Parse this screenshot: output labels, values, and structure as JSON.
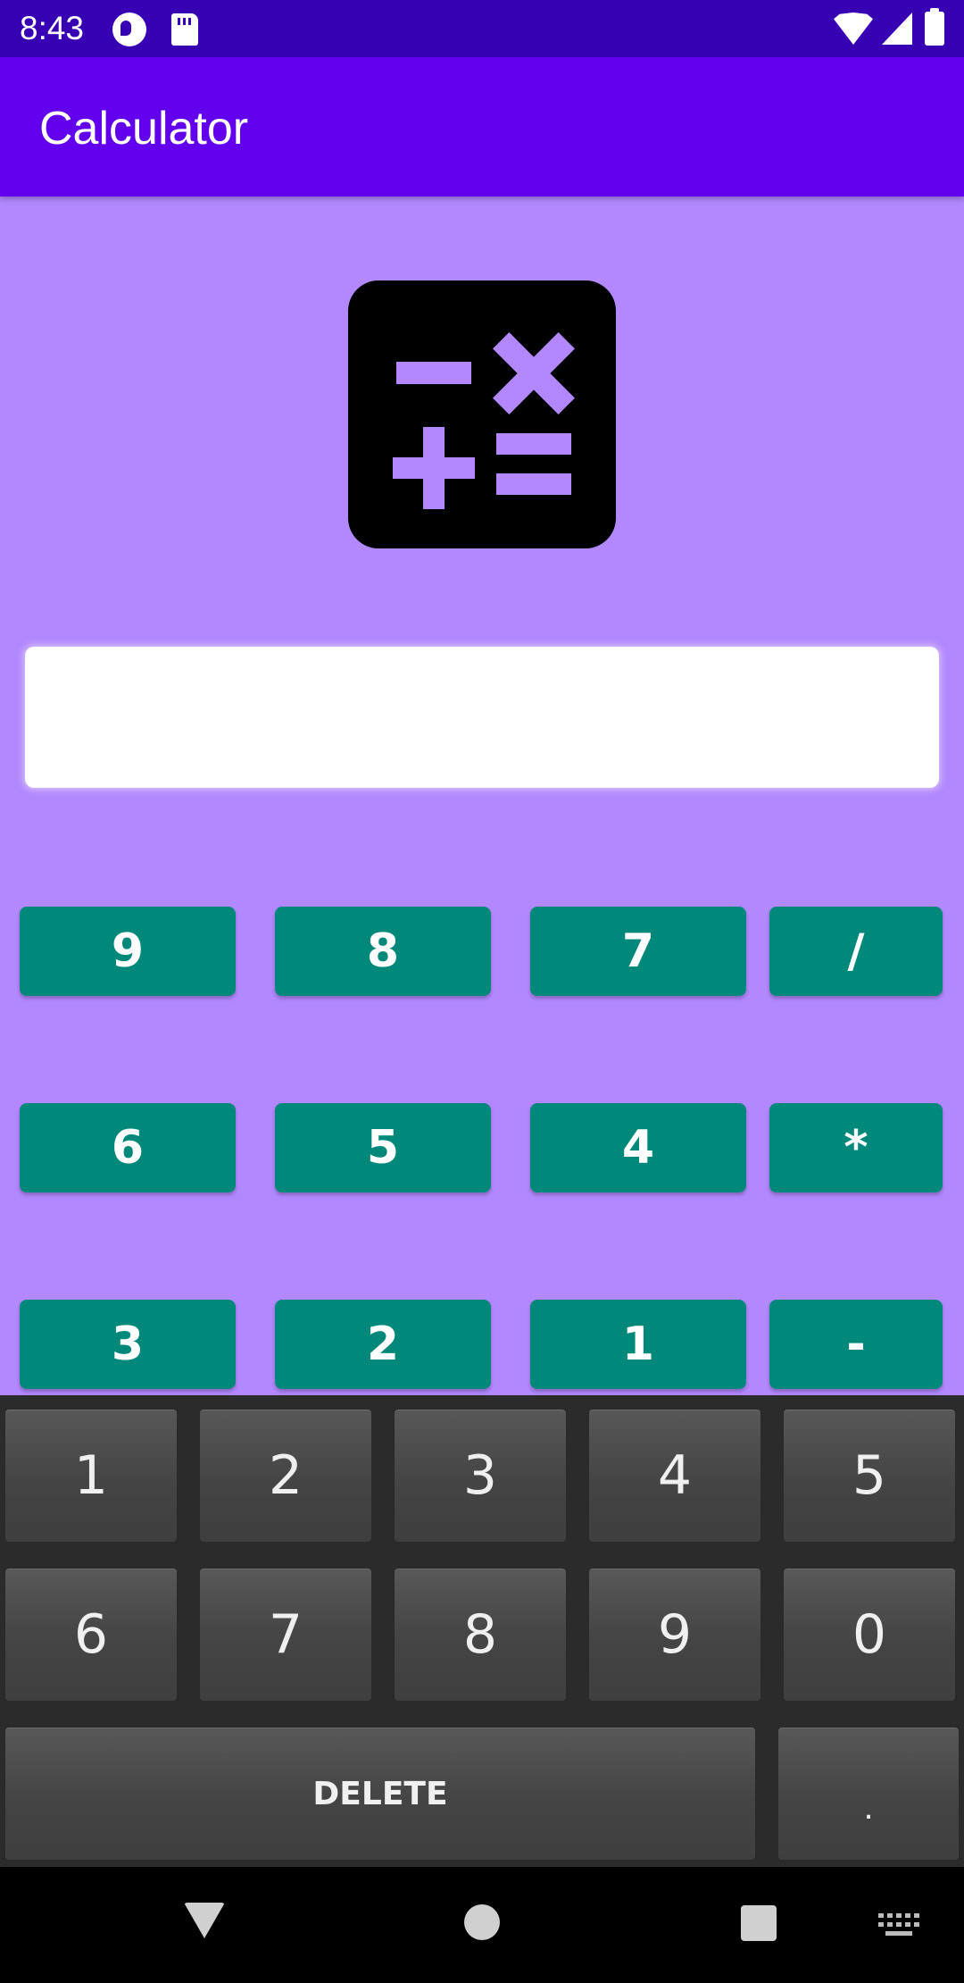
{
  "status_bar": {
    "time": "8:43",
    "icons": [
      "app-notification-icon",
      "sd-card-icon",
      "wifi-icon",
      "cellular-signal-icon",
      "battery-icon"
    ]
  },
  "app_bar": {
    "title": "Calculator"
  },
  "logo": {
    "icon": "calculator-operations-icon",
    "bg_color": "#000000",
    "symbol_color": "#b388ff"
  },
  "display": {
    "value": ""
  },
  "calculator_buttons": {
    "row1": [
      "9",
      "8",
      "7",
      "/"
    ],
    "row2": [
      "6",
      "5",
      "4",
      "*"
    ],
    "row3": [
      "3",
      "2",
      "1",
      "-"
    ]
  },
  "keyboard": {
    "row1": [
      "1",
      "2",
      "3",
      "4",
      "5"
    ],
    "row2": [
      "6",
      "7",
      "8",
      "9",
      "0"
    ],
    "delete_label": "DELETE",
    "dot_label": "."
  },
  "colors": {
    "status_bar": "#3700b3",
    "app_bar": "#6200ee",
    "background": "#b388ff",
    "button": "#00897b"
  }
}
